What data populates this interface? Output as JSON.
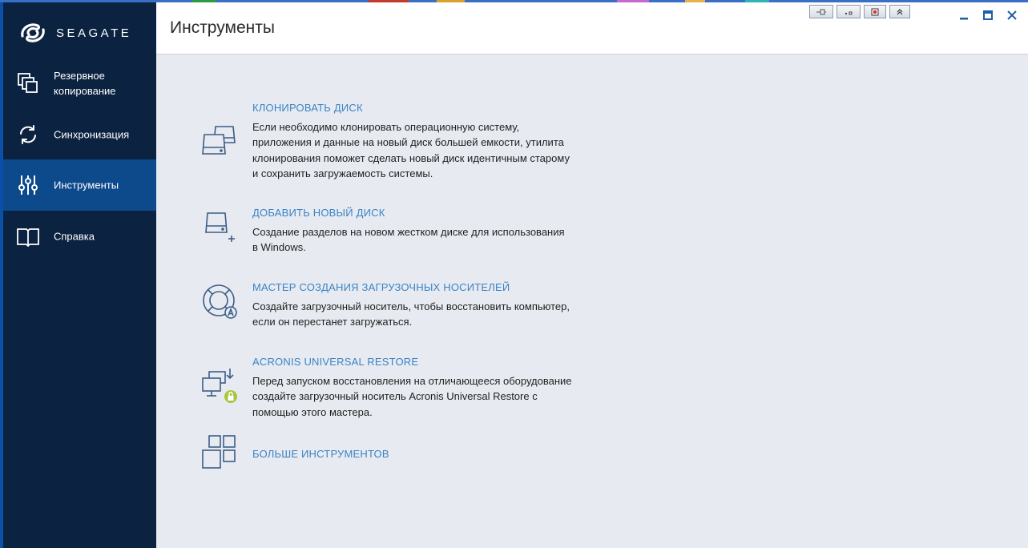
{
  "app": {
    "logo_text": "SEAGATE"
  },
  "colors": {
    "sidebar_bg": "#0b2240",
    "sidebar_active": "#0d4a8c",
    "content_bg": "#e7ebf1",
    "link": "#3b83c5",
    "icon": "#3c5d86"
  },
  "sidebar": {
    "items": [
      {
        "label": "Резервное копирование",
        "icon": "backup-icon",
        "active": false
      },
      {
        "label": "Синхронизация",
        "icon": "sync-icon",
        "active": false
      },
      {
        "label": "Инструменты",
        "icon": "tools-icon",
        "active": true
      },
      {
        "label": "Справка",
        "icon": "book-icon",
        "active": false
      }
    ]
  },
  "header": {
    "title": "Инструменты"
  },
  "window_controls": [
    "minimize-icon",
    "maximize-icon",
    "close-icon"
  ],
  "tools": [
    {
      "title": "КЛОНИРОВАТЬ ДИСК",
      "description": "Если необходимо клонировать операционную систему, приложения и данные на новый диск большей емкости, утилита клонирования поможет сделать новый диск идентичным старому и сохранить загружаемость системы.",
      "icon": "clone-disk-icon"
    },
    {
      "title": "ДОБАВИТЬ НОВЫЙ ДИСК",
      "description": "Создание разделов на новом жестком диске для использования в Windows.",
      "icon": "add-disk-icon"
    },
    {
      "title": "МАСТЕР СОЗДАНИЯ ЗАГРУЗОЧНЫХ НОСИТЕЛЕЙ",
      "description": "Создайте загрузочный носитель, чтобы восстановить компьютер, если он перестанет загружаться.",
      "icon": "lifebuoy-icon"
    },
    {
      "title": "ACRONIS UNIVERSAL RESTORE",
      "description": "Перед запуском восстановления на отличающееся оборудование создайте загрузочный носитель Acronis Universal Restore с помощью этого мастера.",
      "icon": "universal-restore-icon"
    },
    {
      "title": "БОЛЬШЕ ИНСТРУМЕНТОВ",
      "description": "",
      "icon": "more-tools-icon"
    }
  ]
}
